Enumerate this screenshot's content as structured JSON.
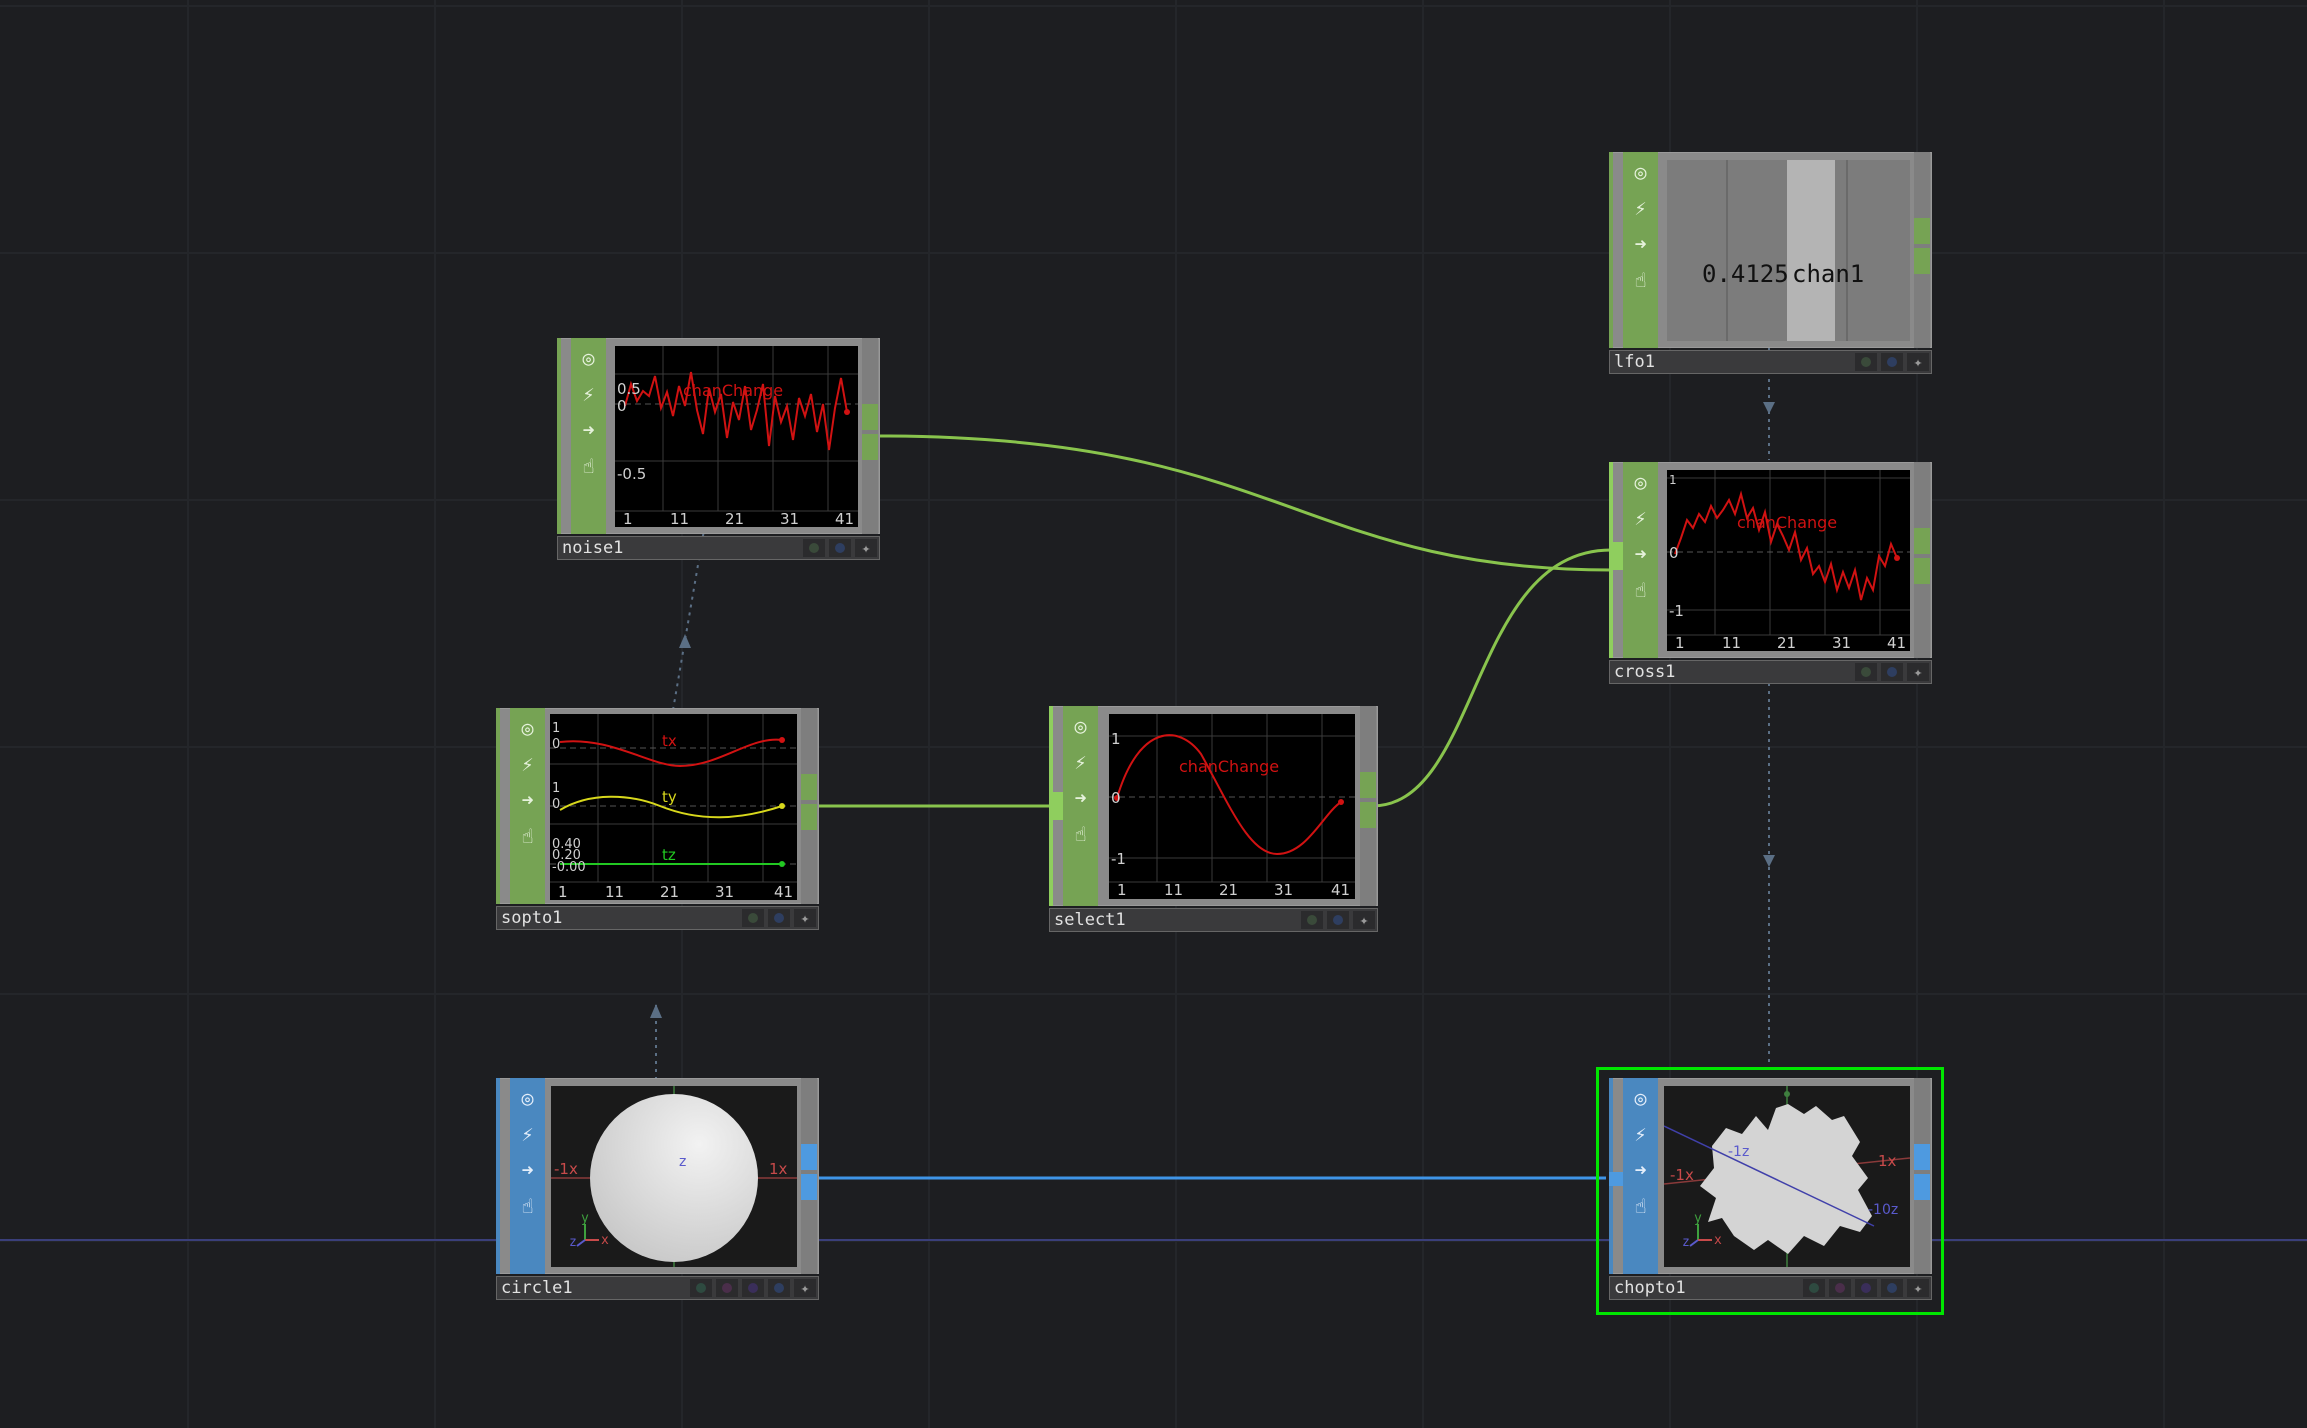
{
  "network": {
    "nodes": [
      {
        "id": "noise1",
        "name": "noise1",
        "family": "chop",
        "viewer": "graph",
        "graph": {
          "channels": [
            {
              "name": "chanChange",
              "color": "#d11212"
            }
          ],
          "y_ticks": [
            "0.5",
            "0",
            "-0.5"
          ],
          "x_ticks": [
            "1",
            "11",
            "21",
            "31",
            "41"
          ]
        }
      },
      {
        "id": "lfo1",
        "name": "lfo1",
        "family": "chop",
        "viewer": "value",
        "value_display": {
          "value": "0.4125",
          "channel": "chan1"
        }
      },
      {
        "id": "cross1",
        "name": "cross1",
        "family": "chop",
        "viewer": "graph",
        "graph": {
          "channels": [
            {
              "name": "chanChange",
              "color": "#d11212"
            }
          ],
          "y_ticks": [
            "1",
            "0",
            "-1"
          ],
          "x_ticks": [
            "1",
            "11",
            "21",
            "31",
            "41"
          ]
        }
      },
      {
        "id": "sopto1",
        "name": "sopto1",
        "family": "chop",
        "viewer": "graph",
        "graph": {
          "channels": [
            {
              "name": "tx",
              "color": "#d11212"
            },
            {
              "name": "ty",
              "color": "#d8d81c"
            },
            {
              "name": "tz",
              "color": "#22c822"
            }
          ],
          "y_ticks": [
            "1",
            "0",
            "1",
            "0",
            "0.40",
            "0.20",
            "-0.00"
          ],
          "x_ticks": [
            "1",
            "11",
            "21",
            "31",
            "41"
          ]
        }
      },
      {
        "id": "select1",
        "name": "select1",
        "family": "chop",
        "viewer": "graph",
        "graph": {
          "channels": [
            {
              "name": "chanChange",
              "color": "#d11212"
            }
          ],
          "y_ticks": [
            "1",
            "0",
            "-1"
          ],
          "x_ticks": [
            "1",
            "11",
            "21",
            "31",
            "41"
          ]
        }
      },
      {
        "id": "circle1",
        "name": "circle1",
        "family": "sop",
        "viewer": "3d",
        "axes": {
          "neg_x": "-1x",
          "pos_x": "1x",
          "z": "z",
          "gizmo": [
            "y",
            "x",
            "z"
          ]
        }
      },
      {
        "id": "chopto1",
        "name": "chopto1",
        "family": "sop",
        "viewer": "3d",
        "selected": true,
        "axes": {
          "neg_x": "-1x",
          "pos_x": "1x",
          "neg_z": "-1z",
          "neg_z2": "-10z",
          "gizmo": [
            "y",
            "x",
            "z"
          ]
        }
      }
    ],
    "colors": {
      "chop": "#76a354",
      "chop_port": "#8fce5e",
      "sop": "#4a88c0",
      "sop_port": "#4e9ae0",
      "wire_chop": "#89c44d",
      "wire_sop": "#3f95e8",
      "export_link": "#5b6f85",
      "selection": "#00e600",
      "background": "#1d1e21"
    },
    "viewer_button_icons": [
      "bypass-icon",
      "lock-icon",
      "arrow-right-icon",
      "display-flag-icon"
    ]
  }
}
